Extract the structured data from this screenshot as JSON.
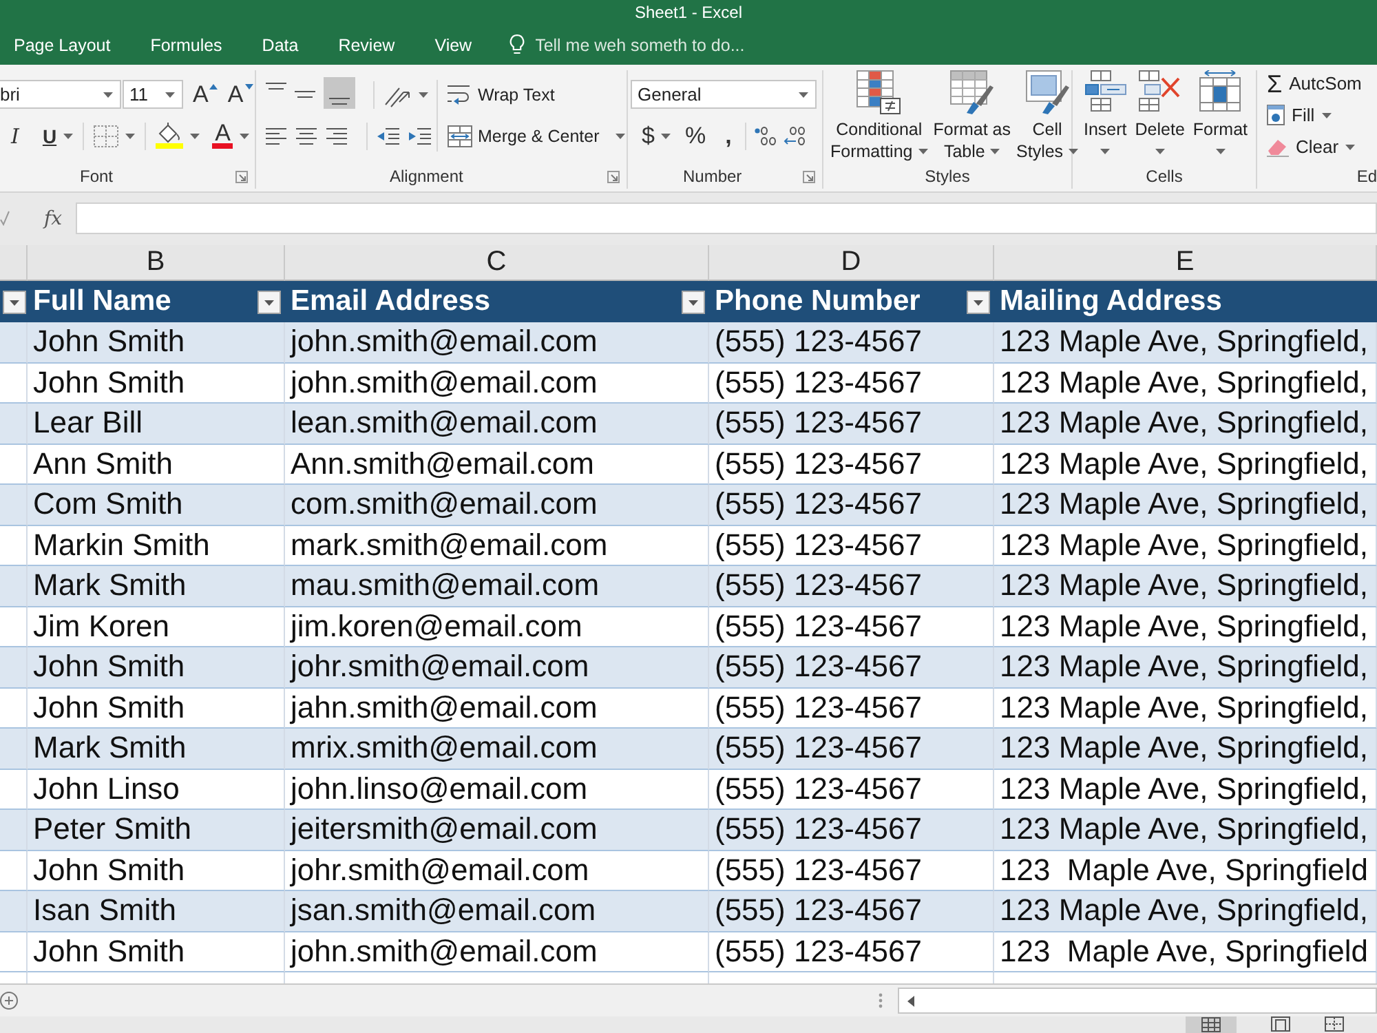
{
  "title_bar": {
    "title": "Sheet1 - Excel"
  },
  "tabs": [
    {
      "label": "Page Layout",
      "selected": false
    },
    {
      "label": "Formules",
      "selected": false
    },
    {
      "label": "Data",
      "selected": false
    },
    {
      "label": "Review",
      "selected": false
    },
    {
      "label": "View",
      "selected": false
    }
  ],
  "tell_me": {
    "placeholder": "Tell me weh someth to do..."
  },
  "ribbon": {
    "font": {
      "label": "Font",
      "font_name": "bri",
      "font_size": "11",
      "size_buttons": [
        {
          "kind": "grow",
          "glyph": "A"
        },
        {
          "kind": "shrink",
          "glyph": "A"
        }
      ],
      "format_buttons": [
        {
          "kind": "italic",
          "glyph": "I"
        },
        {
          "kind": "underline",
          "glyph": "U"
        },
        {
          "kind": "borders"
        },
        {
          "kind": "fill_color"
        },
        {
          "kind": "font_color",
          "glyph": "A"
        }
      ]
    },
    "alignment": {
      "label": "Alignment",
      "vertical": [
        {
          "kind": "top",
          "selected": false
        },
        {
          "kind": "middle",
          "selected": false
        },
        {
          "kind": "bottom",
          "selected": true
        }
      ],
      "wrap_text": "Wrap Text",
      "merge_center": "Merge & Center"
    },
    "number": {
      "label": "Number",
      "format": "General",
      "symbols": [
        {
          "kind": "currency",
          "glyph": "$"
        },
        {
          "kind": "percent",
          "glyph": "%"
        },
        {
          "kind": "comma",
          "glyph": ","
        }
      ]
    },
    "styles": {
      "label": "Styles",
      "buttons": [
        {
          "kind": "conditional",
          "lines": [
            "Conditional",
            "Formatting"
          ]
        },
        {
          "kind": "table",
          "lines": [
            "Format as",
            "Table"
          ]
        },
        {
          "kind": "cell_styles",
          "lines": [
            "Cell",
            "Styles"
          ]
        }
      ]
    },
    "cells": {
      "label": "Cells",
      "buttons": [
        {
          "kind": "insert",
          "label": "Insert"
        },
        {
          "kind": "delete",
          "label": "Delete"
        },
        {
          "kind": "format",
          "label": "Format"
        }
      ]
    },
    "editing": {
      "label": "Ed",
      "buttons": [
        {
          "kind": "sum",
          "glyph": "Σ",
          "label": "AutcSom"
        },
        {
          "kind": "fill",
          "label": "Fill"
        },
        {
          "kind": "clear",
          "label": "Clear"
        }
      ]
    }
  },
  "formula_bar": {
    "function_button": "fx"
  },
  "table": {
    "columns": [
      {
        "letter": "B",
        "header": "Full Name",
        "filter_button": true
      },
      {
        "letter": "C",
        "header": "Email Address",
        "filter_button": true
      },
      {
        "letter": "D",
        "header": "Phone Number",
        "filter_button": true
      },
      {
        "letter": "E",
        "header": "Mailing Address",
        "filter_button": false
      }
    ],
    "rows": [
      [
        "John Smith",
        "john.smith@email.com",
        "(555) 123-4567",
        "123 Maple Ave, Springfield,"
      ],
      [
        "John Smith",
        "john.smith@email.com",
        "(555) 123-4567",
        "123 Maple Ave, Springfield,"
      ],
      [
        "Lear Bill",
        "lean.smith@email.com",
        "(555) 123-4567",
        "123 Maple Ave, Springfield,"
      ],
      [
        "Ann Smith",
        "Ann.smith@email.com",
        "(555) 123-4567",
        "123 Maple Ave, Springfield,"
      ],
      [
        "Com Smith",
        "com.smith@email.com",
        "(555) 123-4567",
        "123 Maple Ave, Springfield,"
      ],
      [
        "Markin Smith",
        "mark.smith@email.com",
        "(555) 123-4567",
        "123 Maple Ave, Springfield,"
      ],
      [
        "Mark Smith",
        "mau.smith@email.com",
        "(555) 123-4567",
        "123 Maple Ave, Springfield,"
      ],
      [
        "Jim Koren",
        "jim.koren@email.com",
        "(555) 123-4567",
        "123 Maple Ave, Springfield,"
      ],
      [
        "John Smith",
        "johr.smith@email.com",
        "(555) 123-4567",
        "123 Maple Ave, Springfield,"
      ],
      [
        "John Smith",
        "jahn.smith@email.com",
        "(555) 123-4567",
        "123 Maple Ave, Springfield,"
      ],
      [
        "Mark Smith",
        "mrix.smith@email.com",
        "(555) 123-4567",
        "123 Maple Ave, Springfield,"
      ],
      [
        "John Linso",
        "john.linso@email.com",
        "(555) 123-4567",
        "123 Maple Ave, Springfield,"
      ],
      [
        "Peter Smith",
        "jeitersmith@email.com",
        "(555) 123-4567",
        "123 Maple Ave, Springfield,"
      ],
      [
        "John Smith",
        "johr.smith@email.com",
        "(555) 123-4567",
        "123  Maple Ave, Springfield"
      ],
      [
        "Isan Smith",
        "jsan.smith@email.com",
        "(555) 123-4567",
        "123 Maple Ave, Springfield,"
      ],
      [
        "John Smith",
        "john.smith@email.com",
        "(555) 123-4567",
        "123  Maple Ave, Springfield"
      ]
    ]
  },
  "status_bar": {
    "view_buttons": [
      {
        "kind": "normal",
        "selected": true
      },
      {
        "kind": "page_layout",
        "selected": false
      },
      {
        "kind": "page_break",
        "selected": false
      }
    ]
  }
}
